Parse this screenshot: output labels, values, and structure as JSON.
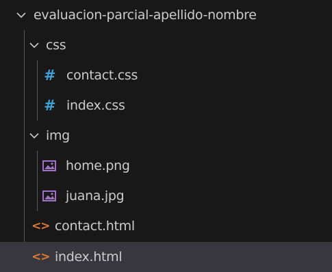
{
  "explorer": {
    "root_folder": "evaluacion-parcial-apellido-nombre",
    "items": [
      {
        "label": "css"
      },
      {
        "label": "contact.css"
      },
      {
        "label": "index.css"
      },
      {
        "label": "img"
      },
      {
        "label": "home.png"
      },
      {
        "label": "juana.jpg"
      },
      {
        "label": "contact.html"
      },
      {
        "label": "index.html"
      }
    ],
    "icons": {
      "folder_expanded": "chevron-down-icon",
      "css_file": "css-file-icon",
      "image_file": "image-file-icon",
      "html_file": "html-file-icon"
    },
    "colors": {
      "background": "#181818",
      "selected_row": "#37373d",
      "text": "#cccccc",
      "css_icon": "#3fa1d6",
      "image_icon": "#a074c4",
      "html_icon": "#e37933"
    }
  }
}
